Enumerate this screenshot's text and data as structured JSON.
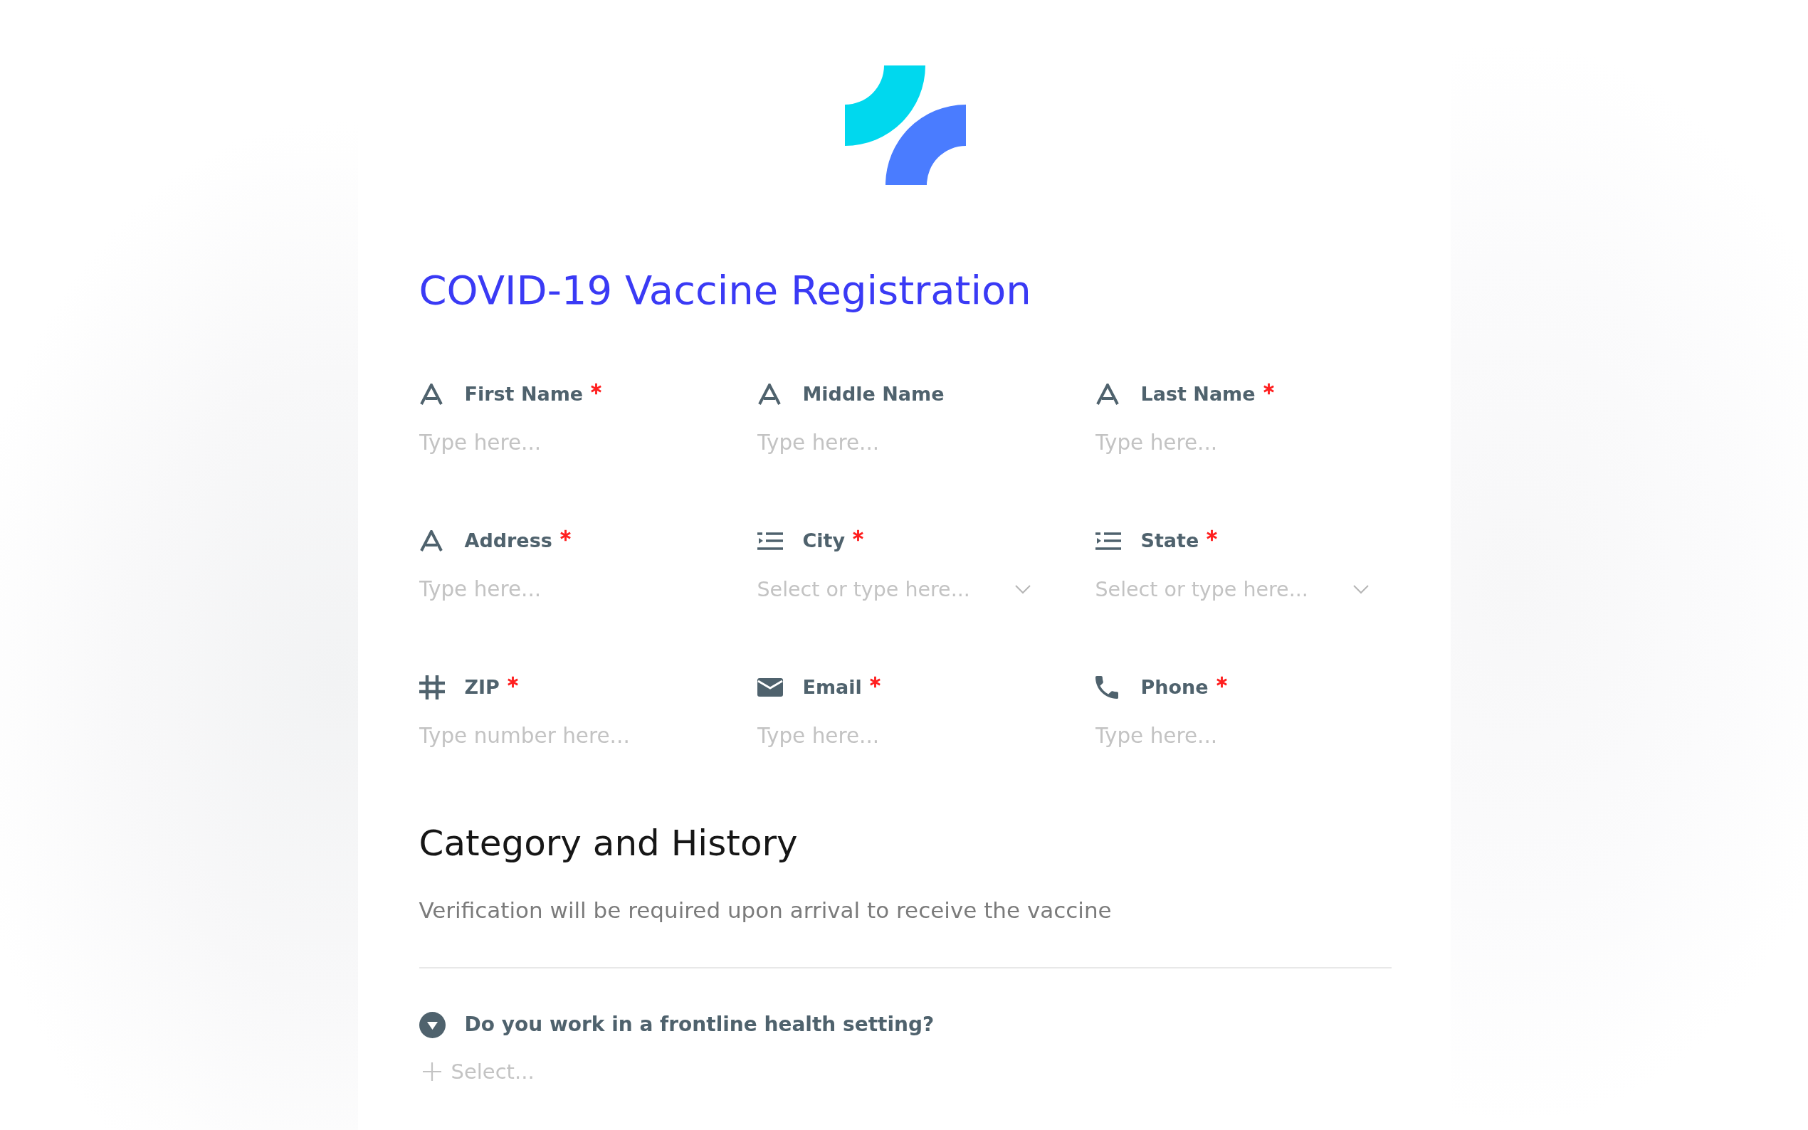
{
  "title": "COVID-19 Vaccine Registration",
  "fields": [
    {
      "kind": "text",
      "label": "First Name",
      "required": true,
      "placeholder": "Type here..."
    },
    {
      "kind": "text",
      "label": "Middle Name",
      "required": false,
      "placeholder": "Type here..."
    },
    {
      "kind": "text",
      "label": "Last Name",
      "required": true,
      "placeholder": "Type here..."
    },
    {
      "kind": "text",
      "label": "Address",
      "required": true,
      "placeholder": "Type here..."
    },
    {
      "kind": "select",
      "label": "City",
      "required": true,
      "placeholder": "Select or type here..."
    },
    {
      "kind": "select",
      "label": "State",
      "required": true,
      "placeholder": "Select or type here..."
    },
    {
      "kind": "number",
      "label": "ZIP",
      "required": true,
      "placeholder": "Type number here..."
    },
    {
      "kind": "email",
      "label": "Email",
      "required": true,
      "placeholder": "Type here..."
    },
    {
      "kind": "phone",
      "label": "Phone",
      "required": true,
      "placeholder": "Type here..."
    }
  ],
  "section": {
    "heading": "Category and History",
    "description": "Verification will be required upon arrival to receive the vaccine",
    "questions": [
      {
        "kind": "single_select",
        "label": "Do you work in a frontline health setting?",
        "placeholder": "Select..."
      }
    ]
  }
}
